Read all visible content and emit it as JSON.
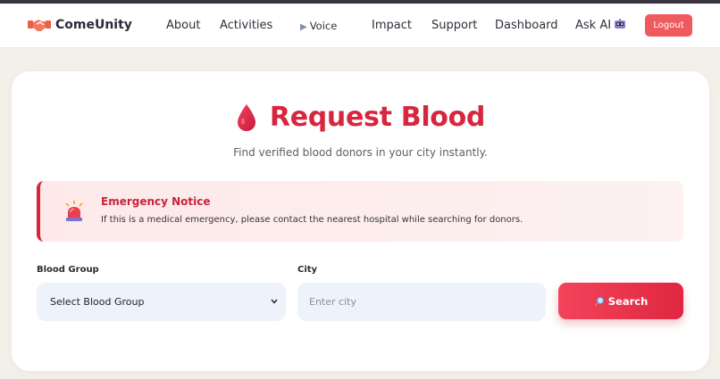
{
  "brand": {
    "name": "ComeUnity",
    "icon": "handshake-icon"
  },
  "nav": {
    "about": "About",
    "activities": "Activities",
    "voice": "Voice",
    "impact": "Impact",
    "support": "Support",
    "dashboard": "Dashboard",
    "ask_ai": "Ask AI",
    "logout": "Logout"
  },
  "page": {
    "title": "Request Blood",
    "title_icon": "blood-drop-icon",
    "subtitle": "Find verified blood donors in your city instantly."
  },
  "notice": {
    "icon": "siren-icon",
    "title": "Emergency Notice",
    "text": "If this is a medical emergency, please contact the nearest hospital while searching for donors."
  },
  "form": {
    "blood_group_label": "Blood Group",
    "blood_group_value": "Select Blood Group",
    "city_label": "City",
    "city_placeholder": "Enter city",
    "city_value": "",
    "search_label": "Search"
  },
  "colors": {
    "accent": "#d7263d",
    "button": "#ef5a5e",
    "input_bg": "#eef2fb",
    "notice_bg": "#fde9e9"
  }
}
